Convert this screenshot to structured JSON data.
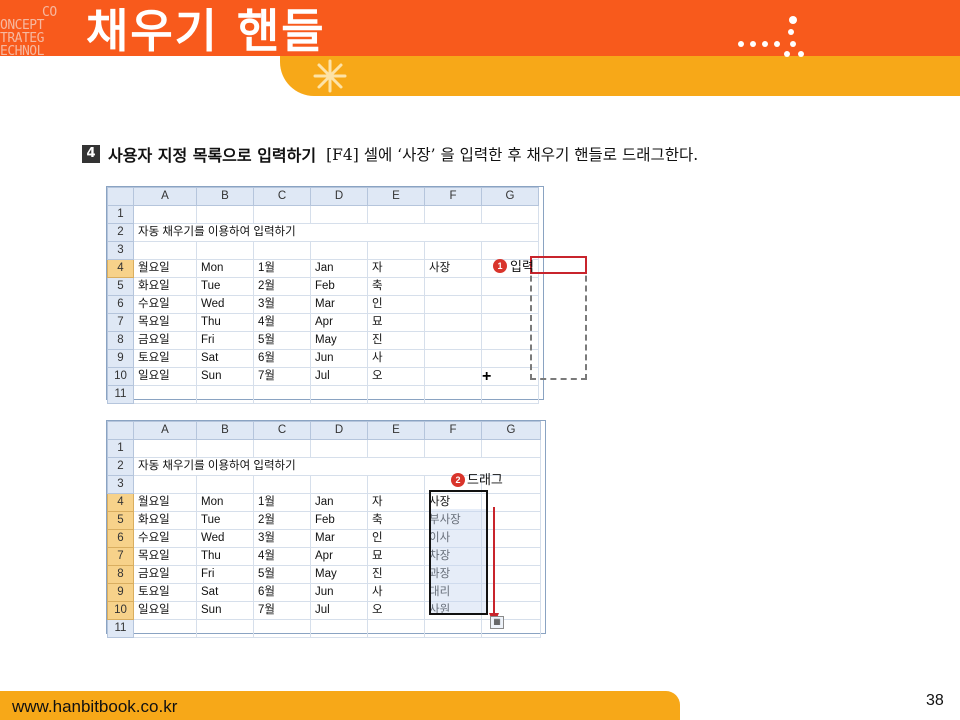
{
  "header": {
    "logo_lines": [
      "CO",
      "ONCEPT",
      "TRATEG",
      "ECHNOL"
    ],
    "title": "채우기 핸들"
  },
  "step": {
    "number": "4",
    "heading": "사용자 지정 목록으로 입력하기",
    "body": "[F4] 셀에 ‘사장’ 을 입력한 후 채우기 핸들로 드래그한다."
  },
  "sheet1": {
    "columns": [
      "A",
      "B",
      "C",
      "D",
      "E",
      "F",
      "G"
    ],
    "row_labels": [
      "1",
      "2",
      "3",
      "4",
      "5",
      "6",
      "7",
      "8",
      "9",
      "10",
      "11"
    ],
    "title_cell": "자동 채우기를 이용하여 입력하기",
    "rows": [
      [
        "월요일",
        "Mon",
        "1월",
        "Jan",
        "자",
        "사장",
        ""
      ],
      [
        "화요일",
        "Tue",
        "2월",
        "Feb",
        "축",
        "",
        ""
      ],
      [
        "수요일",
        "Wed",
        "3월",
        "Mar",
        "인",
        "",
        ""
      ],
      [
        "목요일",
        "Thu",
        "4월",
        "Apr",
        "묘",
        "",
        ""
      ],
      [
        "금요일",
        "Fri",
        "5월",
        "May",
        "진",
        "",
        ""
      ],
      [
        "토요일",
        "Sat",
        "6월",
        "Jun",
        "사",
        "",
        ""
      ],
      [
        "일요일",
        "Sun",
        "7월",
        "Jul",
        "오",
        "",
        ""
      ]
    ],
    "callout_number": "1",
    "callout_text": "입력",
    "cursor": "+"
  },
  "sheet2": {
    "columns": [
      "A",
      "B",
      "C",
      "D",
      "E",
      "F",
      "G"
    ],
    "row_labels": [
      "1",
      "2",
      "3",
      "4",
      "5",
      "6",
      "7",
      "8",
      "9",
      "10",
      "11"
    ],
    "title_cell": "자동 채우기를 이용하여 입력하기",
    "rows": [
      [
        "월요일",
        "Mon",
        "1월",
        "Jan",
        "자",
        "사장",
        ""
      ],
      [
        "화요일",
        "Tue",
        "2월",
        "Feb",
        "축",
        "부사장",
        ""
      ],
      [
        "수요일",
        "Wed",
        "3월",
        "Mar",
        "인",
        "이사",
        ""
      ],
      [
        "목요일",
        "Thu",
        "4월",
        "Apr",
        "묘",
        "차장",
        ""
      ],
      [
        "금요일",
        "Fri",
        "5월",
        "May",
        "진",
        "과장",
        ""
      ],
      [
        "토요일",
        "Sat",
        "6월",
        "Jun",
        "사",
        "대리",
        ""
      ],
      [
        "일요일",
        "Sun",
        "7월",
        "Jul",
        "오",
        "사원",
        ""
      ]
    ],
    "callout_number": "2",
    "callout_text": "드래그"
  },
  "footer": {
    "url": "www.hanbitbook.co.kr",
    "page": "38"
  },
  "colors": {
    "header_red": "#f85a1c",
    "header_orange": "#f7a818",
    "selection_red": "#c8242c",
    "badge_red": "#d9342b",
    "column_header_blue": "#dfe8f5",
    "selected_header_gold": "#f7d28a"
  }
}
